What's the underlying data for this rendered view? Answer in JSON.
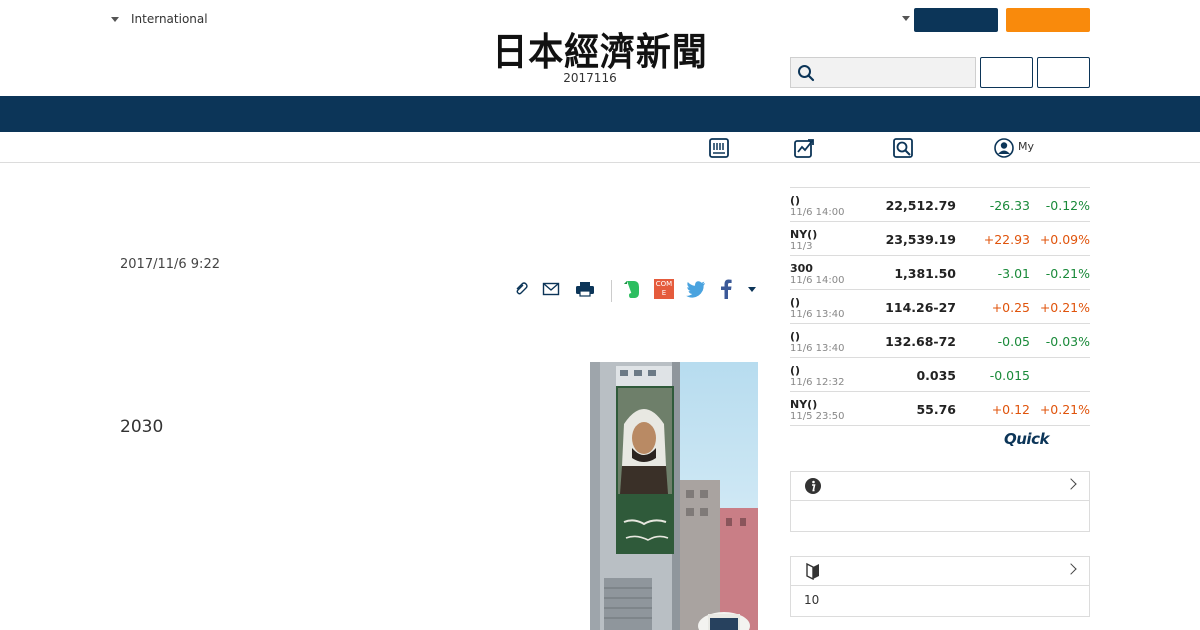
{
  "header": {
    "region_link": "International",
    "logo_text": "日本經濟新聞",
    "edition_date": "2017116",
    "search_placeholder": ""
  },
  "subnav": {
    "my_label": "My"
  },
  "article": {
    "date": "2017/11/6 9:22",
    "lead": "2030"
  },
  "share_icons": [
    "clip-icon",
    "mail-icon",
    "print-icon",
    "evernote-icon",
    "come-icon",
    "twitter-icon",
    "facebook-icon"
  ],
  "come_icon_text": "COME",
  "market": {
    "rows": [
      {
        "name": "()",
        "time": "11/6 14:00",
        "value": "22,512.79",
        "change": "-26.33",
        "pct": "-0.12%",
        "dir": "down"
      },
      {
        "name": "NY()",
        "time": "11/3",
        "value": "23,539.19",
        "change": "+22.93",
        "pct": "+0.09%",
        "dir": "up"
      },
      {
        "name": "300",
        "time": "11/6 14:00",
        "value": "1,381.50",
        "change": "-3.01",
        "pct": "-0.21%",
        "dir": "down"
      },
      {
        "name": "()",
        "time": "11/6 13:40",
        "value": "114.26-27",
        "change": "+0.25",
        "pct": "+0.21%",
        "dir": "up"
      },
      {
        "name": "()",
        "time": "11/6 13:40",
        "value": "132.68-72",
        "change": "-0.05",
        "pct": "-0.03%",
        "dir": "down"
      },
      {
        "name": "()",
        "time": "11/6 12:32",
        "value": "0.035",
        "change": "-0.015",
        "pct": "",
        "dir": "down"
      },
      {
        "name": "NY()",
        "time": "11/5 23:50",
        "value": "55.76",
        "change": "+0.12",
        "pct": "+0.21%",
        "dir": "up"
      }
    ],
    "provider": "Quick"
  },
  "sidebox_info": {
    "body": ""
  },
  "sidebox_ranking": {
    "body": "10"
  },
  "colors": {
    "navy": "#0c3558",
    "orange": "#f98a0c",
    "down": "#1a8a3a",
    "up": "#e0540c"
  }
}
